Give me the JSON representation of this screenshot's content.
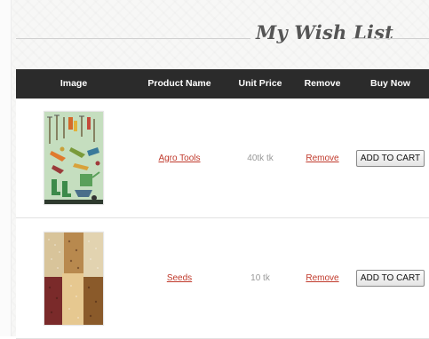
{
  "title": "My Wish List",
  "columns": {
    "image": "Image",
    "product_name": "Product Name",
    "unit_price": "Unit Price",
    "remove": "Remove",
    "buy_now": "Buy Now"
  },
  "items": [
    {
      "name": "Agro Tools",
      "price": "40tk tk",
      "remove": "Remove",
      "button": "ADD TO CART",
      "image_icon": "garden-tools-image"
    },
    {
      "name": "Seeds",
      "price": "10 tk",
      "remove": "Remove",
      "button": "ADD TO CART",
      "image_icon": "seeds-image"
    }
  ],
  "colors": {
    "header_bg": "#2b2b2b",
    "link": "#c0392b"
  }
}
